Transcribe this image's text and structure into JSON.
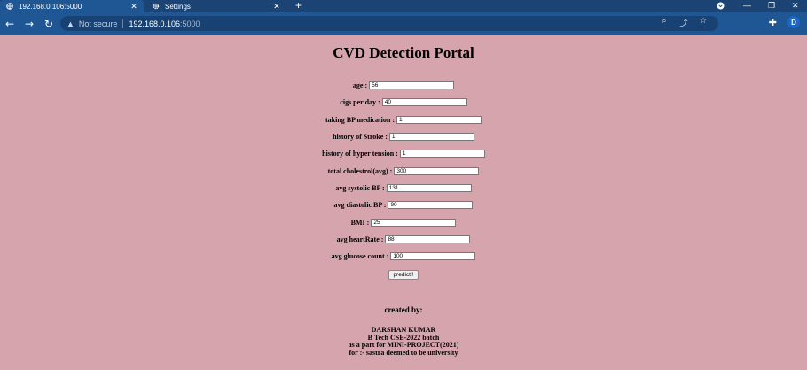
{
  "browser": {
    "tabs": [
      {
        "title": "192.168.0.106:5000",
        "active": true
      },
      {
        "title": "Settings",
        "active": false
      }
    ],
    "new_tab": "+",
    "url": {
      "security_label": "Not secure",
      "host": "192.168.0.106",
      "port": ":5000"
    },
    "profile_initial": "D",
    "colors": {
      "tabstrip": "#1b4474",
      "toolbar": "#1f5794",
      "omnibox": "#174273",
      "page_bg": "#d6a4ad"
    },
    "icons": [
      "back-icon",
      "forward-icon",
      "reload-icon",
      "warning-icon",
      "zoom-icon",
      "share-icon",
      "star-icon",
      "extensions-icon",
      "gear-icon",
      "globe-icon"
    ]
  },
  "page": {
    "title": "CVD Detection Portal",
    "fields": [
      {
        "label": "age :",
        "value": "56"
      },
      {
        "label": "cigs per day :",
        "value": "40"
      },
      {
        "label": "taking BP medication :",
        "value": "1"
      },
      {
        "label": "history of Stroke :",
        "value": "1"
      },
      {
        "label": "history of hyper tension :",
        "value": "1"
      },
      {
        "label": "total cholestrol(avg) :",
        "value": "300"
      },
      {
        "label": "avg systolic BP :",
        "value": "131"
      },
      {
        "label": "avg diastolic BP :",
        "value": "90"
      },
      {
        "label": "BMI :",
        "value": "25"
      },
      {
        "label": "avg heartRate :",
        "value": "88"
      },
      {
        "label": "avg glucose count :",
        "value": "100"
      }
    ],
    "predict_label": "predict!!",
    "created_by": "created by:",
    "credits": [
      "DARSHAN KUMAR",
      "B Tech CSE-2022 batch",
      "as a part for MINI-PROJECT(2021)",
      "for :- sastra deemed to be university"
    ]
  }
}
